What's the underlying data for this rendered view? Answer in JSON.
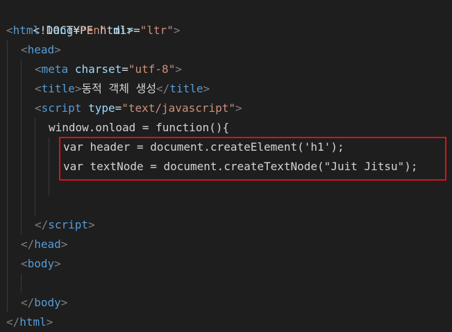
{
  "lines": [
    {
      "doctype": "<!DOCTYPE html>"
    },
    {
      "tag_open": "<",
      "tag": "html",
      "a1": "lang",
      "v1": "\"en\"",
      "a2": "dir",
      "v2": "\"ltr\"",
      "tag_close": ">"
    },
    {
      "tag_open": "<",
      "tag": "head",
      "tag_close": ">"
    },
    {
      "tag_open": "<",
      "tag": "meta",
      "a1": "charset",
      "v1": "\"utf-8\"",
      "tag_close": ">"
    },
    {
      "open1": "<",
      "tag1": "title",
      "close1": ">",
      "text": "동적 객체 생성",
      "open2": "</",
      "tag2": "title",
      "close2": ">"
    },
    {
      "tag_open": "<",
      "tag": "script",
      "a1": "type",
      "v1": "\"text/javascript\"",
      "tag_close": ">"
    },
    {
      "code": "window.onload = function(){"
    },
    {
      "code": "var header = document.createElement('h1');"
    },
    {
      "code": "var textNode = document.createTextNode(\"Juit Jitsu\");"
    },
    {
      "code": ""
    },
    {
      "code": ""
    },
    {
      "tag_open": "</",
      "tag": "script",
      "tag_close": ">"
    },
    {
      "tag_open": "</",
      "tag": "head",
      "tag_close": ">"
    },
    {
      "tag_open": "<",
      "tag": "body",
      "tag_close": ">"
    },
    {
      "code": ""
    },
    {
      "tag_open": "</",
      "tag": "body",
      "tag_close": ">"
    },
    {
      "tag_open": "</",
      "tag": "html",
      "tag_close": ">"
    }
  ],
  "colors": {
    "background": "#1e1e1e",
    "punctuation": "#808080",
    "tag": "#569cd6",
    "attribute": "#9cdcfe",
    "string": "#ce9178",
    "text": "#d4d4d4",
    "highlight_border": "#e0101b"
  }
}
